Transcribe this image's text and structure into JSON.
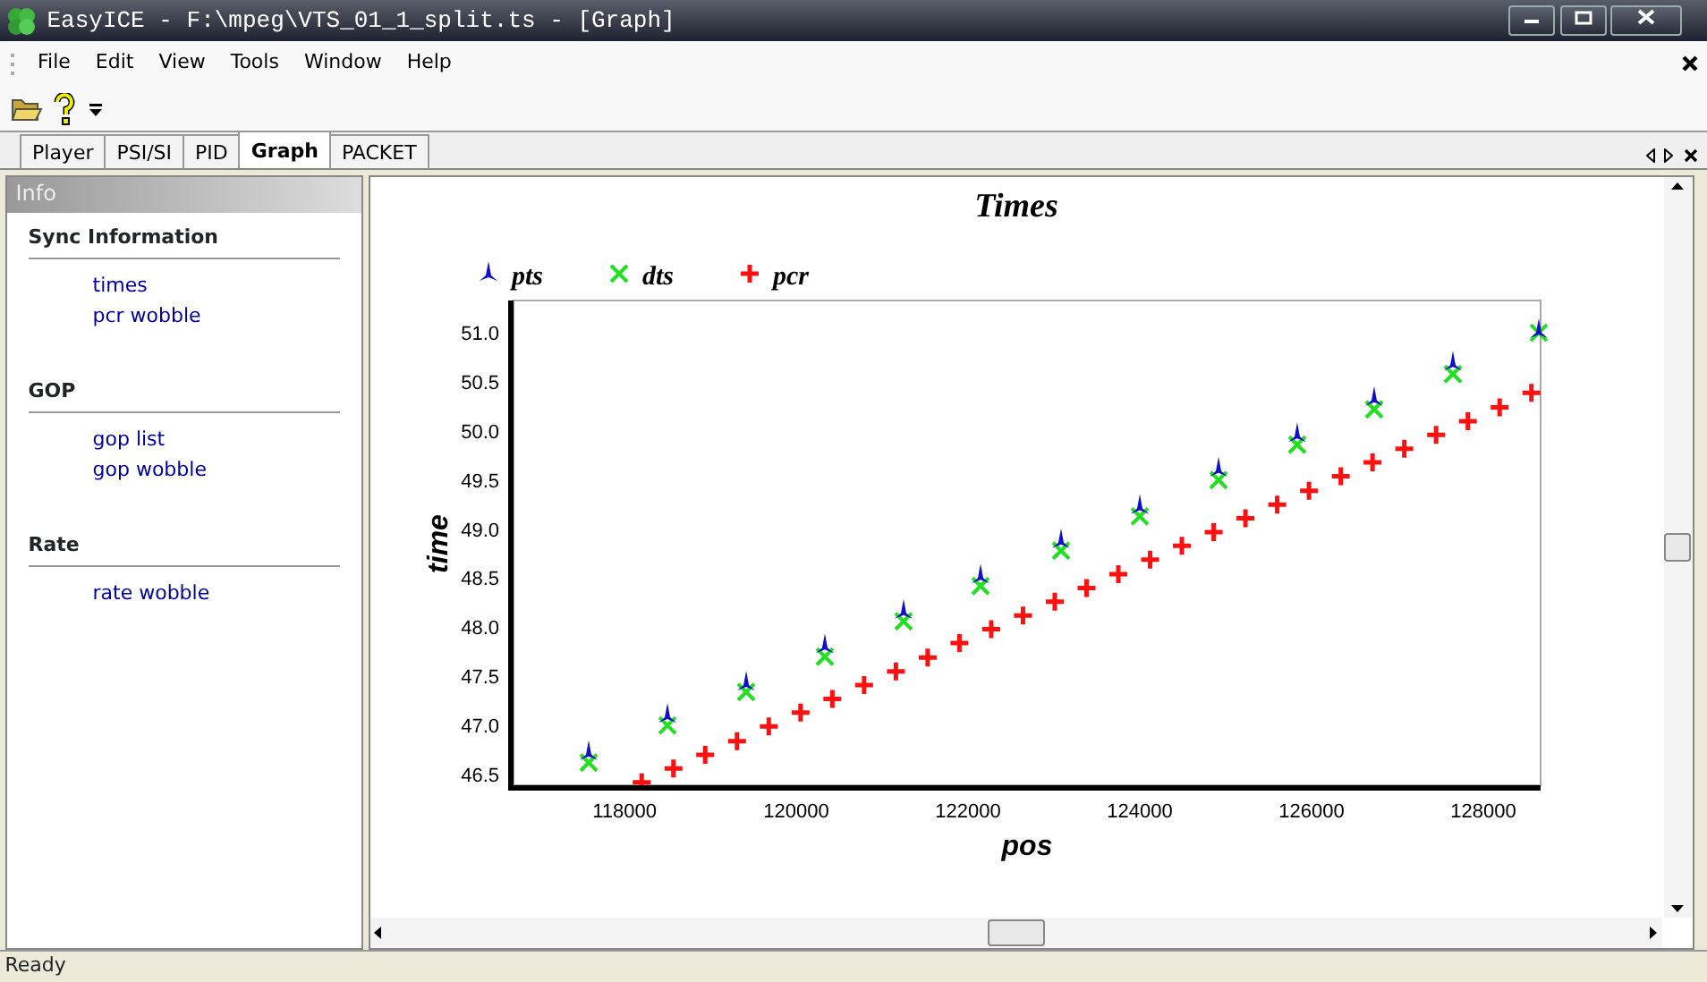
{
  "window": {
    "title": "EasyICE - F:\\mpeg\\VTS_01_1_split.ts - [Graph]"
  },
  "menu": [
    {
      "label": "File"
    },
    {
      "label": "Edit"
    },
    {
      "label": "View"
    },
    {
      "label": "Tools"
    },
    {
      "label": "Window"
    },
    {
      "label": "Help"
    }
  ],
  "tabs": [
    {
      "label": "Player",
      "selected": false
    },
    {
      "label": "PSI/SI",
      "selected": false
    },
    {
      "label": "PID",
      "selected": false
    },
    {
      "label": "Graph",
      "selected": true
    },
    {
      "label": "PACKET",
      "selected": false
    }
  ],
  "sidebar": {
    "title": "Info",
    "sections": [
      {
        "heading": "Sync Information",
        "links": [
          "times",
          "pcr wobble"
        ]
      },
      {
        "heading": "GOP",
        "links": [
          "gop list",
          "gop wobble"
        ]
      },
      {
        "heading": "Rate",
        "links": [
          "rate wobble"
        ]
      }
    ]
  },
  "graph": {
    "chart_data": {
      "type": "scatter",
      "title": "Times",
      "legend": "top-left",
      "xlabel": "pos",
      "ylabel": "time",
      "xlim": [
        116708,
        128667
      ],
      "ylim": [
        46.39,
        51.33
      ],
      "xticks": [
        118000,
        120000,
        122000,
        124000,
        126000,
        128000
      ],
      "yticks": [
        {
          "value": 46.5,
          "label": "46.5"
        },
        {
          "value": 47,
          "label": "47.0"
        },
        {
          "value": 47.5,
          "label": "47.5"
        },
        {
          "value": 48,
          "label": "48.0"
        },
        {
          "value": 48.5,
          "label": "48.5"
        },
        {
          "value": 49,
          "label": "49.0"
        },
        {
          "value": 49.5,
          "label": "49.5"
        },
        {
          "value": 50,
          "label": "50.0"
        },
        {
          "value": 50.5,
          "label": "50.5"
        },
        {
          "value": 51,
          "label": "51.0"
        }
      ],
      "series": [
        {
          "name": "pts",
          "color": "#1010c8",
          "x": [
            117583,
            118500,
            119417,
            120333,
            121250,
            122146,
            123083,
            124000,
            124917,
            125833,
            126729,
            127646,
            128646
          ],
          "values": [
            46.72,
            47.1,
            47.43,
            47.81,
            48.16,
            48.52,
            48.88,
            49.23,
            49.61,
            49.96,
            50.33,
            50.69,
            51.02
          ]
        },
        {
          "name": "dts",
          "color": "#20e020",
          "x": [
            117583,
            118500,
            119417,
            120333,
            121250,
            122146,
            123083,
            124000,
            124917,
            125833,
            126729,
            127646,
            128646
          ],
          "values": [
            46.62,
            47.0,
            47.34,
            47.7,
            48.06,
            48.42,
            48.78,
            49.13,
            49.5,
            49.86,
            50.22,
            50.58,
            51.0
          ]
        },
        {
          "name": "pcr",
          "color": "#ff1010",
          "x": [
            118200,
            118570,
            118940,
            119310,
            119680,
            120050,
            120420,
            120790,
            121160,
            121530,
            121900,
            122270,
            122640,
            123010,
            123380,
            123750,
            124120,
            124490,
            124860,
            125230,
            125600,
            125970,
            126340,
            126710,
            127080,
            127450,
            127820,
            128190,
            128560
          ],
          "values": [
            46.42,
            46.56,
            46.7,
            46.84,
            46.99,
            47.13,
            47.27,
            47.41,
            47.55,
            47.69,
            47.84,
            47.98,
            48.12,
            48.26,
            48.4,
            48.54,
            48.69,
            48.83,
            48.97,
            49.11,
            49.25,
            49.39,
            49.54,
            49.68,
            49.82,
            49.96,
            50.1,
            50.24,
            50.39
          ]
        }
      ]
    }
  },
  "status_bar": {
    "text": "Ready"
  }
}
